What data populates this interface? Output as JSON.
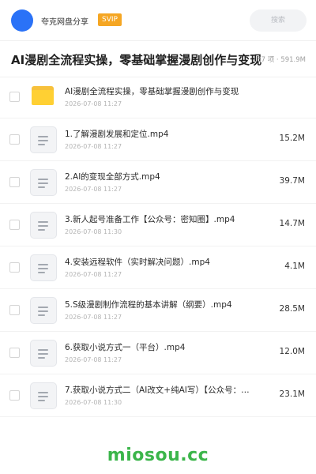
{
  "header": {
    "app_name": "夸克网盘分享",
    "badge": "SVIP",
    "search_placeholder": "搜索"
  },
  "title": {
    "text": "AI漫剧全流程实操，零基础掌握漫剧创作与变现",
    "meta": "87 项 · 591.9M"
  },
  "files": [
    {
      "type": "folder",
      "name": "AI漫剧全流程实操，零基础掌握漫剧创作与变现",
      "date": "2026-07-08 11:27",
      "size": ""
    },
    {
      "type": "file",
      "name": "1.了解漫剧发展和定位.mp4",
      "date": "2026-07-08 11:27",
      "size": "15.2M"
    },
    {
      "type": "file",
      "name": "2.AI的变现全部方式.mp4",
      "date": "2026-07-08 11:27",
      "size": "39.7M"
    },
    {
      "type": "file",
      "name": "3.新人起号准备工作【公众号：密知圈】.mp4",
      "date": "2026-07-08 11:30",
      "size": "14.7M"
    },
    {
      "type": "file",
      "name": "4.安装远程软件（实时解决问题）.mp4",
      "date": "2026-07-08 11:27",
      "size": "4.1M"
    },
    {
      "type": "file",
      "name": "5.S级漫剧制作流程的基本讲解（纲要）.mp4",
      "date": "2026-07-08 11:27",
      "size": "28.5M"
    },
    {
      "type": "file",
      "name": "6.获取小说方式一（平台）.mp4",
      "date": "2026-07-08 11:27",
      "size": "12.0M"
    },
    {
      "type": "file",
      "name": "7.获取小说方式二（AI改文+纯AI写）【公众号：…",
      "date": "2026-07-08 11:30",
      "size": "23.1M"
    }
  ],
  "footer": {
    "watermark": "miosou.cc"
  },
  "colors": {
    "avatar": "#2a72f7",
    "badge": "#f5a623",
    "folder": "#ffd033",
    "watermark": "#3bb54a"
  }
}
